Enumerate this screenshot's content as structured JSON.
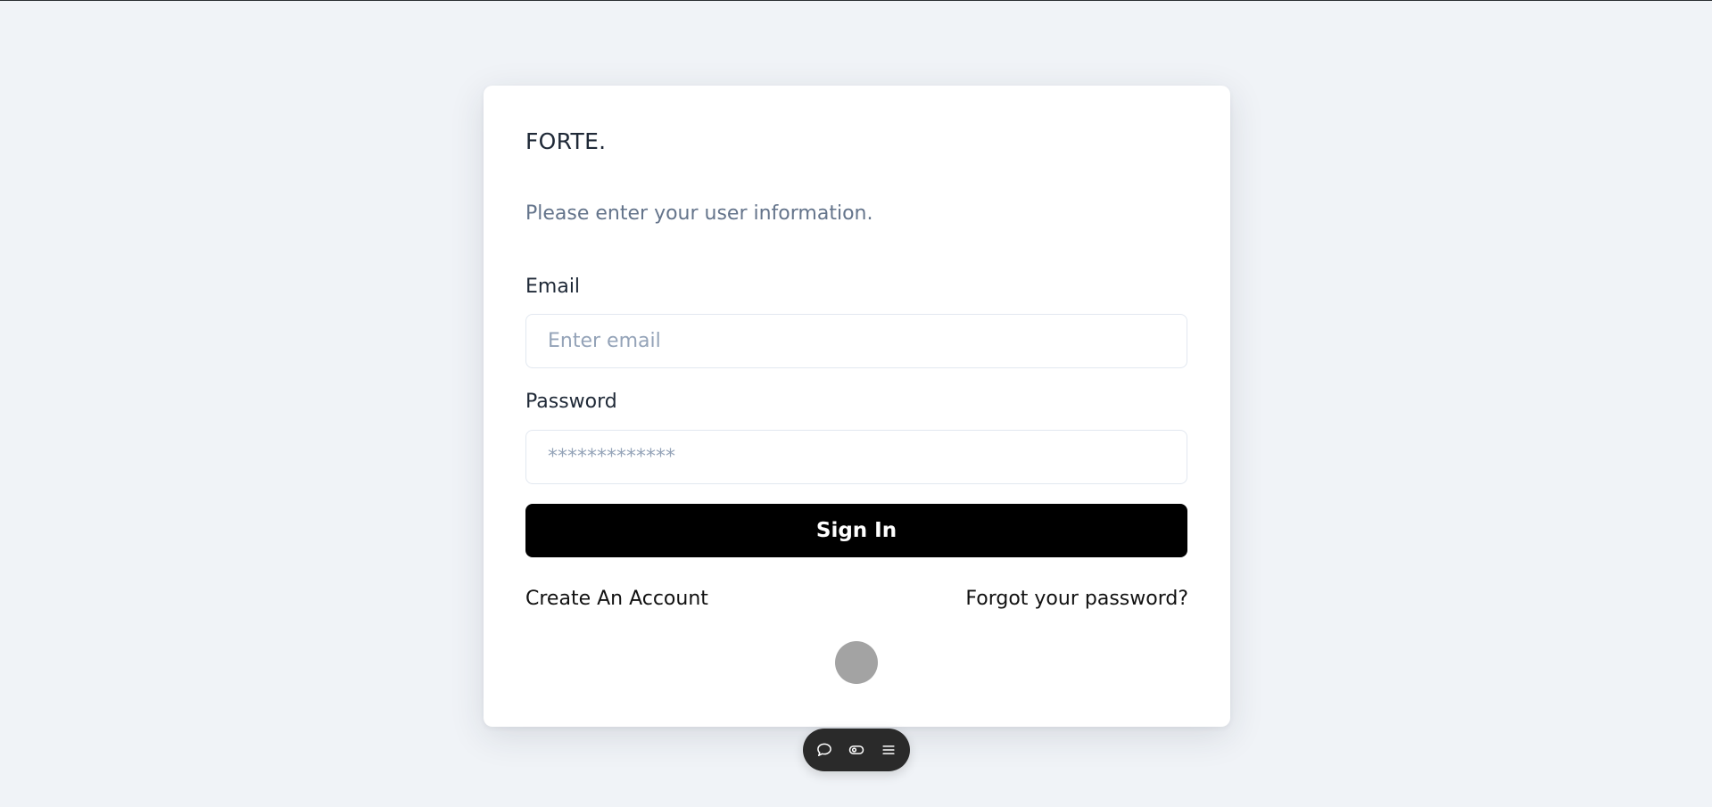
{
  "brand": {
    "name": "FORTE."
  },
  "form": {
    "subtitle": "Please enter your user information.",
    "email": {
      "label": "Email",
      "placeholder": "Enter email",
      "value": ""
    },
    "password": {
      "label": "Password",
      "placeholder": "*************",
      "value": ""
    },
    "submit_label": "Sign In",
    "create_account_label": "Create An Account",
    "forgot_password_label": "Forgot your password?"
  },
  "toolbar": {
    "icons": [
      "chat-bubble-icon",
      "toggle-icon",
      "menu-icon"
    ]
  },
  "colors": {
    "background": "#f0f3f7",
    "card": "#ffffff",
    "button": "#000000",
    "muted_text": "#64748b",
    "spinner": "#a3a3a3",
    "toolbar": "#2a2a2a"
  }
}
